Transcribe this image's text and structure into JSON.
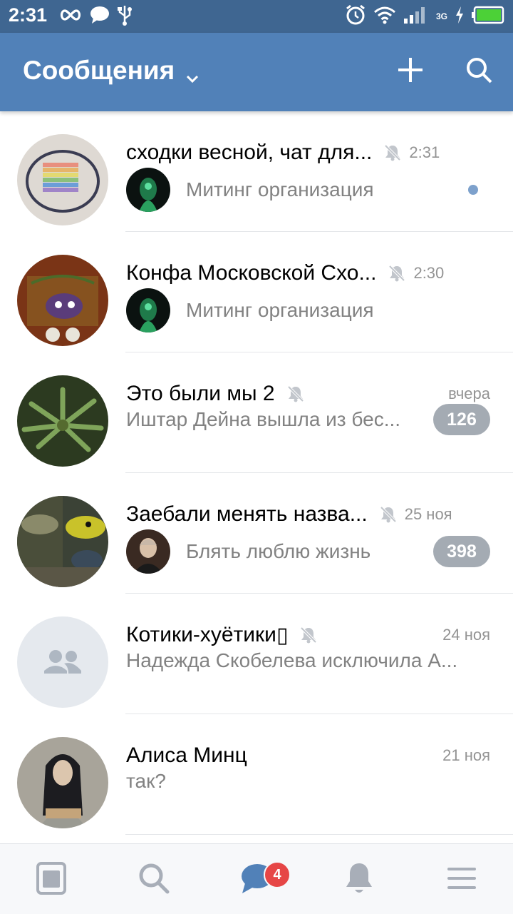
{
  "status_bar": {
    "time": "2:31",
    "network": "3G"
  },
  "header": {
    "title": "Сообщения"
  },
  "dialogs": [
    {
      "title": "сходки весной, чат для...",
      "time": "2:31",
      "muted": true,
      "message": "Митинг организация",
      "unread_dot": true
    },
    {
      "title": "Конфа Московской  Схо...",
      "time": "2:30",
      "muted": true,
      "message": "Митинг организация"
    },
    {
      "title": "Это были мы 2",
      "time": "вчера",
      "muted": true,
      "message": "Иштар Дейна вышла из бес...",
      "counter": "126"
    },
    {
      "title": "Заебали менять назва...",
      "time": "25 ноя",
      "muted": true,
      "message": "Блять люблю жизнь",
      "counter": "398"
    },
    {
      "title": "Котики-хуётики ",
      "title_glyph": "▯",
      "time": "24 ноя",
      "muted": true,
      "message": "Надежда Скобелева исключила А..."
    },
    {
      "title": "Алиса Минц",
      "time": "21 ноя",
      "muted": false,
      "message": "так?"
    }
  ],
  "bottom_nav": {
    "items": [
      "news-icon",
      "search-icon",
      "messages-icon",
      "notifications-icon",
      "menu-icon"
    ],
    "messages_badge": "4"
  },
  "colors": {
    "header_bg": "#5181b8",
    "statusbar_bg": "#3f6691",
    "accent": "#5181b8",
    "badge_red": "#e64646",
    "counter_gray": "#a4abb3"
  }
}
